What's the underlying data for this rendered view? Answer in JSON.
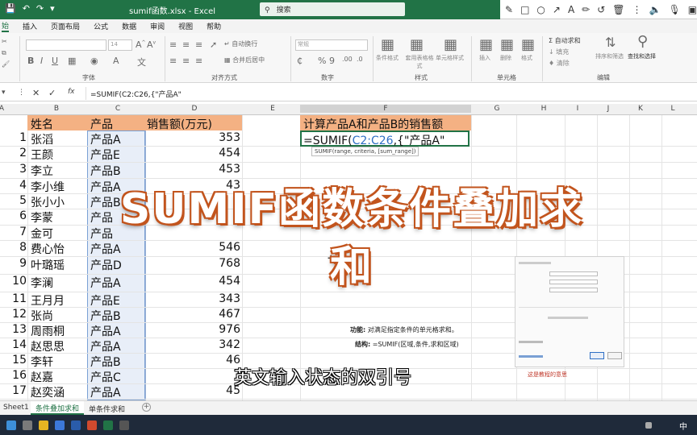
{
  "titlebar": {
    "window_title": "sumif函数.xlsx  -  Excel",
    "search_placeholder": "搜索"
  },
  "ribbon_tabs": [
    "插入",
    "页面布局",
    "公式",
    "数据",
    "审阅",
    "视图",
    "帮助"
  ],
  "ribbon": {
    "font_name": "等线",
    "font_size": "14",
    "autowrap": "自动换行",
    "merge_center": "合并后居中",
    "number_format": "常规",
    "cond_format": "条件格式",
    "table_format": "套用表格格式",
    "cell_style": "单元格样式",
    "insert": "插入",
    "delete": "删除",
    "format": "格式",
    "autosum": "自动求和",
    "fill": "填充",
    "clear": "清除",
    "sort_filter": "排序和筛选",
    "find_select": "查找和选择",
    "groups": {
      "font": "字体",
      "align": "对齐方式",
      "number": "数字",
      "style": "样式",
      "cells": "单元格",
      "edit": "编辑"
    }
  },
  "formula_bar": {
    "content": "=SUMIF(C2:C26,{\"产品A\""
  },
  "columns": [
    "A",
    "B",
    "C",
    "D",
    "E",
    "F",
    "G",
    "H",
    "I",
    "J",
    "K",
    "L"
  ],
  "table": {
    "headers": [
      "姓名",
      "产品",
      "销售额(万元)"
    ],
    "rows": [
      {
        "n": "1",
        "name": "张滔",
        "product": "产品A",
        "sales": "353"
      },
      {
        "n": "2",
        "name": "王颜",
        "product": "产品E",
        "sales": "454"
      },
      {
        "n": "3",
        "name": "李立",
        "product": "产品B",
        "sales": "453"
      },
      {
        "n": "4",
        "name": "李小维",
        "product": "产品A",
        "sales": "43"
      },
      {
        "n": "5",
        "name": "张小小",
        "product": "产品B",
        "sales": ""
      },
      {
        "n": "6",
        "name": "李蒙",
        "product": "产品",
        "sales": ""
      },
      {
        "n": "7",
        "name": "金可",
        "product": "产品",
        "sales": ""
      },
      {
        "n": "8",
        "name": "费心怡",
        "product": "产品A",
        "sales": "546"
      },
      {
        "n": "9",
        "name": "叶璐瑶",
        "product": "产品D",
        "sales": "768"
      },
      {
        "n": "10",
        "name": "李澜",
        "product": "产品A",
        "sales": "454"
      },
      {
        "n": "11",
        "name": "王月月",
        "product": "产品E",
        "sales": "343"
      },
      {
        "n": "12",
        "name": "张尚",
        "product": "产品B",
        "sales": "467"
      },
      {
        "n": "13",
        "name": "周雨桐",
        "product": "产品A",
        "sales": "976"
      },
      {
        "n": "14",
        "name": "赵思思",
        "product": "产品A",
        "sales": "342"
      },
      {
        "n": "15",
        "name": "李轩",
        "product": "产品B",
        "sales": "46"
      },
      {
        "n": "16",
        "name": "赵嘉",
        "product": "产品C",
        "sales": "7"
      },
      {
        "n": "17",
        "name": "赵奕涵",
        "product": "产品A",
        "sales": "45"
      }
    ]
  },
  "calc": {
    "label": "计算产品A和产品B的销售额",
    "formula_prefix": "=SUMIF(",
    "formula_range": "C2:C26",
    "formula_suffix": ",{\"产品A\"",
    "tooltip": "SUMIF(range, criteria, [sum_range])"
  },
  "info": {
    "func_label": "功能:",
    "func_text": "对满足指定条件的单元格求和。",
    "struct_label": "结构:",
    "struct_text": "=SUMIF(区域,条件,求和区域)"
  },
  "overlay": {
    "title": "SUMIF函数条件叠加求和",
    "subtitle": "英文输入状态的双引号",
    "small_note": "这是教程的意思"
  },
  "sheets": [
    "Sheet1",
    "条件叠加求和",
    "单条件求和"
  ],
  "colors": {
    "excel_green": "#217346",
    "header_orange": "#f4b183",
    "title_outline": "#c2541d"
  }
}
